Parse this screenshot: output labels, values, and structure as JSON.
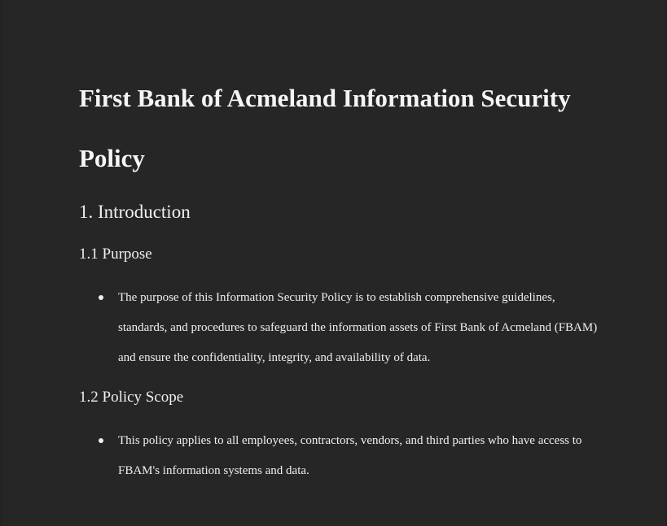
{
  "document": {
    "title": "First Bank of Acmeland Information Security Policy",
    "sections": [
      {
        "heading": "1. Introduction",
        "subsections": [
          {
            "heading": "1.1 Purpose",
            "bullets": [
              "The purpose of this Information Security Policy is to establish comprehensive guidelines, standards, and procedures to safeguard the information assets of First Bank of Acmeland (FBAM) and ensure the confidentiality, integrity, and availability of data."
            ]
          },
          {
            "heading": "1.2 Policy Scope",
            "bullets": [
              "This policy applies to all employees, contractors, vendors, and third parties who have access to FBAM's information systems and data."
            ]
          }
        ]
      }
    ]
  }
}
